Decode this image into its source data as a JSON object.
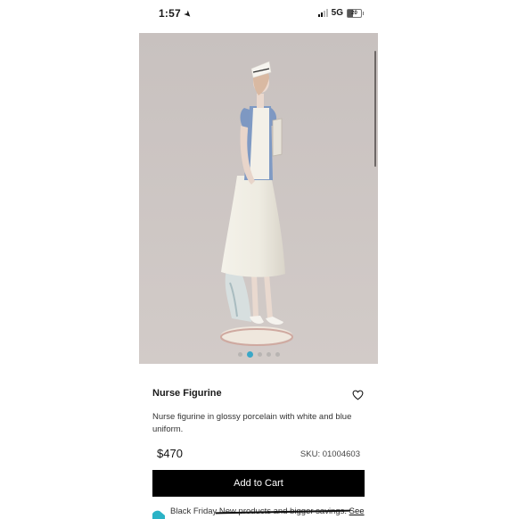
{
  "status_bar": {
    "time": "1:57",
    "network": "5G",
    "battery": "20"
  },
  "product": {
    "title": "Nurse Figurine",
    "description": "Nurse figurine in glossy porcelain with white and blue uniform.",
    "price": "$470",
    "sku_label": "SKU: 01004603",
    "gallery": {
      "image_count": 5,
      "active_index": 1
    }
  },
  "actions": {
    "add_to_cart": "Add to Cart",
    "wishlist_icon": "heart-icon"
  },
  "promo": {
    "prefix": "Black Friday",
    "struck": "New products and bigger savings.",
    "link": "See"
  },
  "colors": {
    "image_background": "#cac3c0",
    "active_dot": "#3aa7c7",
    "button": "#000000"
  }
}
